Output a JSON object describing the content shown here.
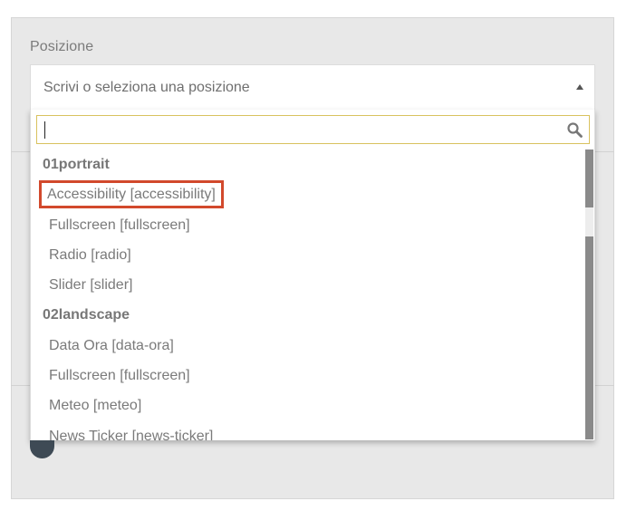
{
  "field": {
    "label": "Posizione",
    "placeholder": "Scrivi o seleziona una posizione"
  },
  "search": {
    "value": ""
  },
  "options": [
    {
      "type": "group",
      "label": "01portrait"
    },
    {
      "type": "item",
      "label": "Accessibility [accessibility]",
      "highlighted": true
    },
    {
      "type": "item",
      "label": "Fullscreen [fullscreen]"
    },
    {
      "type": "item",
      "label": "Radio [radio]"
    },
    {
      "type": "item",
      "label": "Slider [slider]"
    },
    {
      "type": "group",
      "label": "02landscape"
    },
    {
      "type": "item",
      "label": "Data Ora [data-ora]"
    },
    {
      "type": "item",
      "label": "Fullscreen [fullscreen]"
    },
    {
      "type": "item",
      "label": "Meteo [meteo]"
    },
    {
      "type": "item",
      "label": "News Ticker [news-ticker]"
    }
  ],
  "colors": {
    "highlight_border": "#d2492c",
    "search_border": "#d9c25e"
  },
  "icons": {
    "search": "search-icon",
    "collapse": "arrow-up-icon"
  }
}
